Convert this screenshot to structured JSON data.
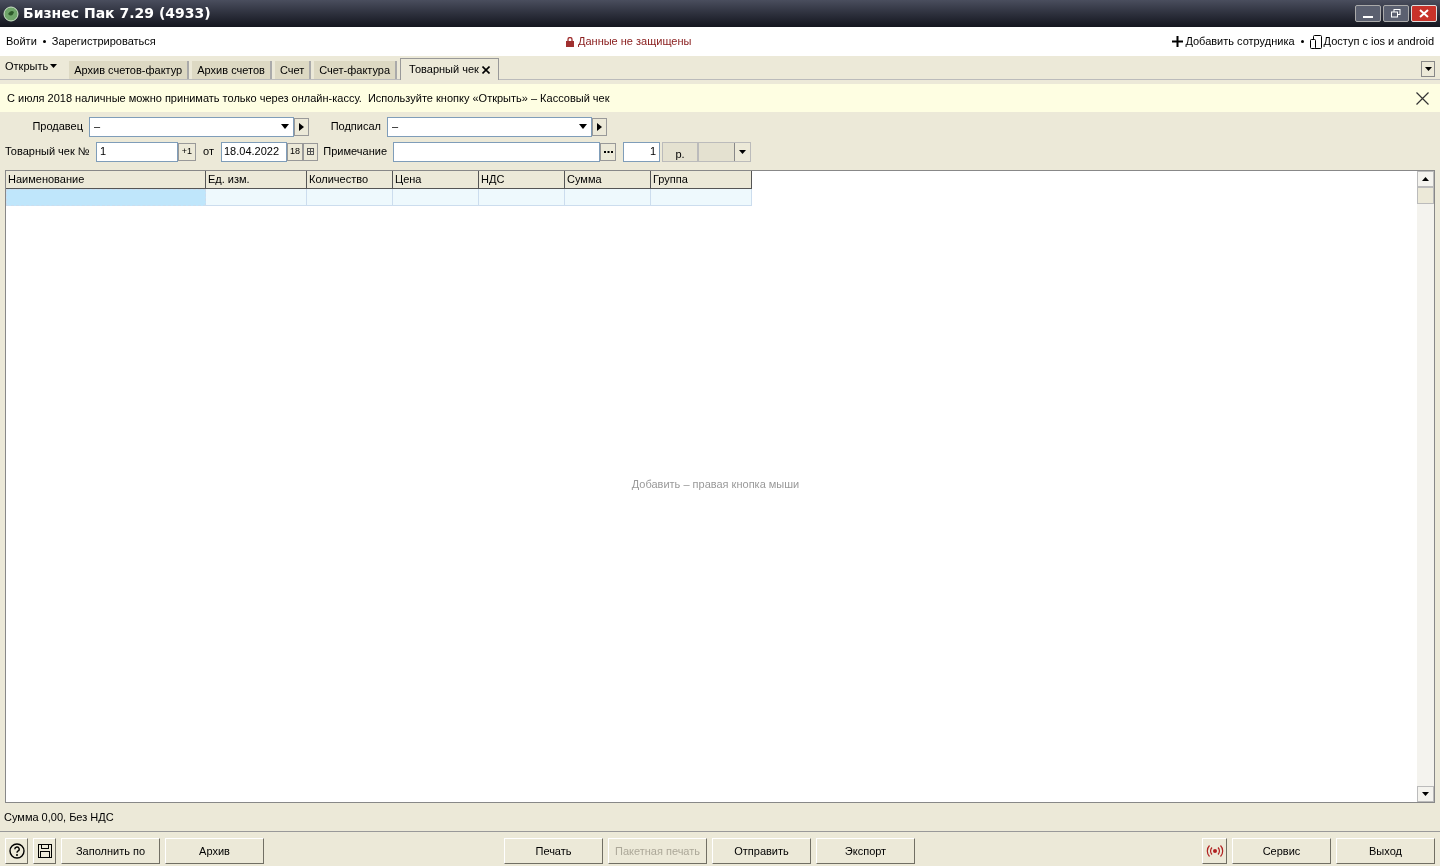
{
  "window": {
    "title": "Бизнес Пак 7.29 (4933)"
  },
  "top_bar": {
    "left_links": [
      "Войти",
      "Зарегистрироваться"
    ],
    "security_notice": "Данные не защищены",
    "right_links": [
      {
        "kind": "add",
        "label": "Добавить сотрудника"
      },
      {
        "kind": "phone",
        "label": "Доступ с ios и android"
      }
    ]
  },
  "open_menu": "Открыть",
  "tabs": [
    {
      "label": "Архив счетов-фактур",
      "selected": false,
      "closable": false
    },
    {
      "label": "Архив счетов",
      "selected": false,
      "closable": false
    },
    {
      "label": "Счет",
      "selected": false,
      "closable": false
    },
    {
      "label": "Счет-фактура",
      "selected": false,
      "closable": false
    },
    {
      "label": "Товарный чек",
      "selected": true,
      "closable": true
    }
  ],
  "banner": "С июля 2018 наличные можно принимать только через онлайн-кассу.  Используйте кнопку «Открыть» – Кассовый чек",
  "form": {
    "seller": {
      "label": "Продавец",
      "value": "–"
    },
    "signed": {
      "label": "Подписал",
      "value": "–"
    },
    "receipt_number": {
      "label": "Товарный чек №",
      "value": "1",
      "increment": "+1"
    },
    "date": {
      "label": "от",
      "value": "18.04.2022",
      "calendar": "18"
    },
    "note": {
      "label": "Примечание"
    },
    "quantity": "1",
    "currency": "р."
  },
  "table": {
    "columns": [
      "Наименование",
      "Ед. изм.",
      "Количество",
      "Цена",
      "НДС",
      "Сумма",
      "Группа"
    ],
    "rows": [
      {
        "selected": true
      }
    ],
    "empty_hint": "Добавить – правая кнопка мыши"
  },
  "status": "Сумма 0,00, Без НДС",
  "button_groups": {
    "left": [
      {
        "kind": "help",
        "disabled": false
      },
      {
        "kind": "save",
        "disabled": false
      },
      {
        "kind": "text",
        "label": "Заполнить по",
        "disabled": false
      },
      {
        "kind": "text",
        "label": "Архив",
        "disabled": false
      }
    ],
    "center": [
      {
        "kind": "text",
        "label": "Печать",
        "disabled": false
      },
      {
        "kind": "text",
        "label": "Пакетная печать",
        "disabled": true
      },
      {
        "kind": "text",
        "label": "Отправить",
        "disabled": false
      },
      {
        "kind": "text",
        "label": "Экспорт",
        "disabled": false
      }
    ],
    "right": [
      {
        "kind": "signal",
        "disabled": false
      },
      {
        "kind": "text",
        "label": "Сервис",
        "disabled": false
      },
      {
        "kind": "text",
        "label": "Выход",
        "disabled": false
      }
    ]
  }
}
